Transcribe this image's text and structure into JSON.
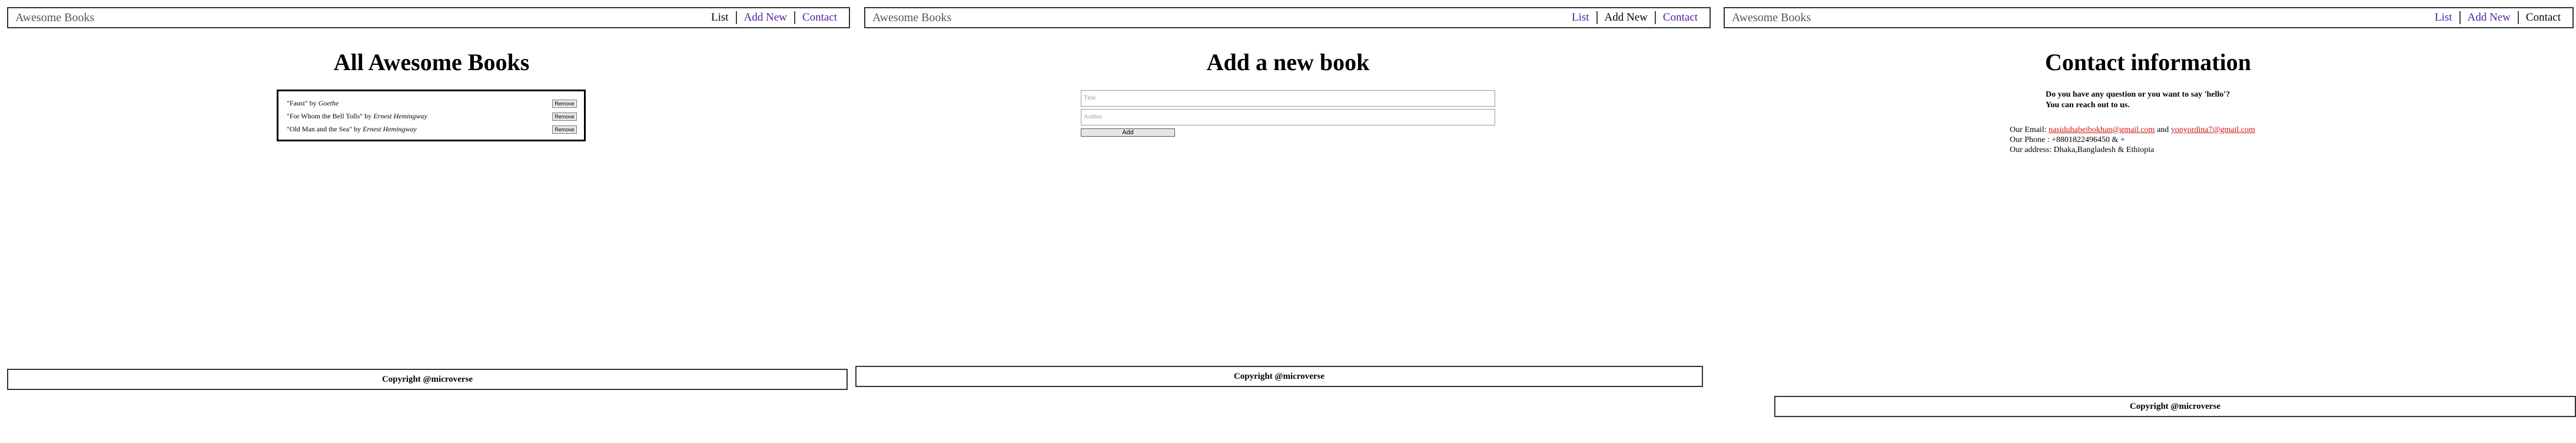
{
  "nav": {
    "brand": "Awesome Books",
    "list": "List",
    "add_new": "Add New",
    "contact": "Contact"
  },
  "list_view": {
    "title": "All Awesome Books",
    "books": [
      {
        "title": "\"Faust\" by ",
        "author": "Goethe",
        "remove": "Remove"
      },
      {
        "title": "\"For Whom the Bell Tolls\" by ",
        "author": "Ernest Hemingway",
        "remove": "Remove"
      },
      {
        "title": "\"Old Man and the Sea\" by ",
        "author": "Ernest Hemingway",
        "remove": "Remove"
      }
    ]
  },
  "add_view": {
    "title": "Add a new book",
    "title_placeholder": "Title",
    "author_placeholder": "Author",
    "add_label": "Add"
  },
  "contact_view": {
    "title": "Contact information",
    "question_line1": "Do you have any question or you want to say 'hello'?",
    "question_line2": "You can reach out to us.",
    "email_prefix": "Our Email: ",
    "email1": "nasiduhabeibokhan@gmail.com",
    "email_and": " and ",
    "email2": "yonyordina7@gmail.com",
    "phone": "Our Phone : +8801822496450 & +",
    "address": "Our address: Dhaka,Bangladesh & Ethiopia"
  },
  "footer": {
    "copyright": "Copyright @microverse"
  },
  "colors": {
    "link": "#5020a0",
    "email": "#d01010"
  }
}
